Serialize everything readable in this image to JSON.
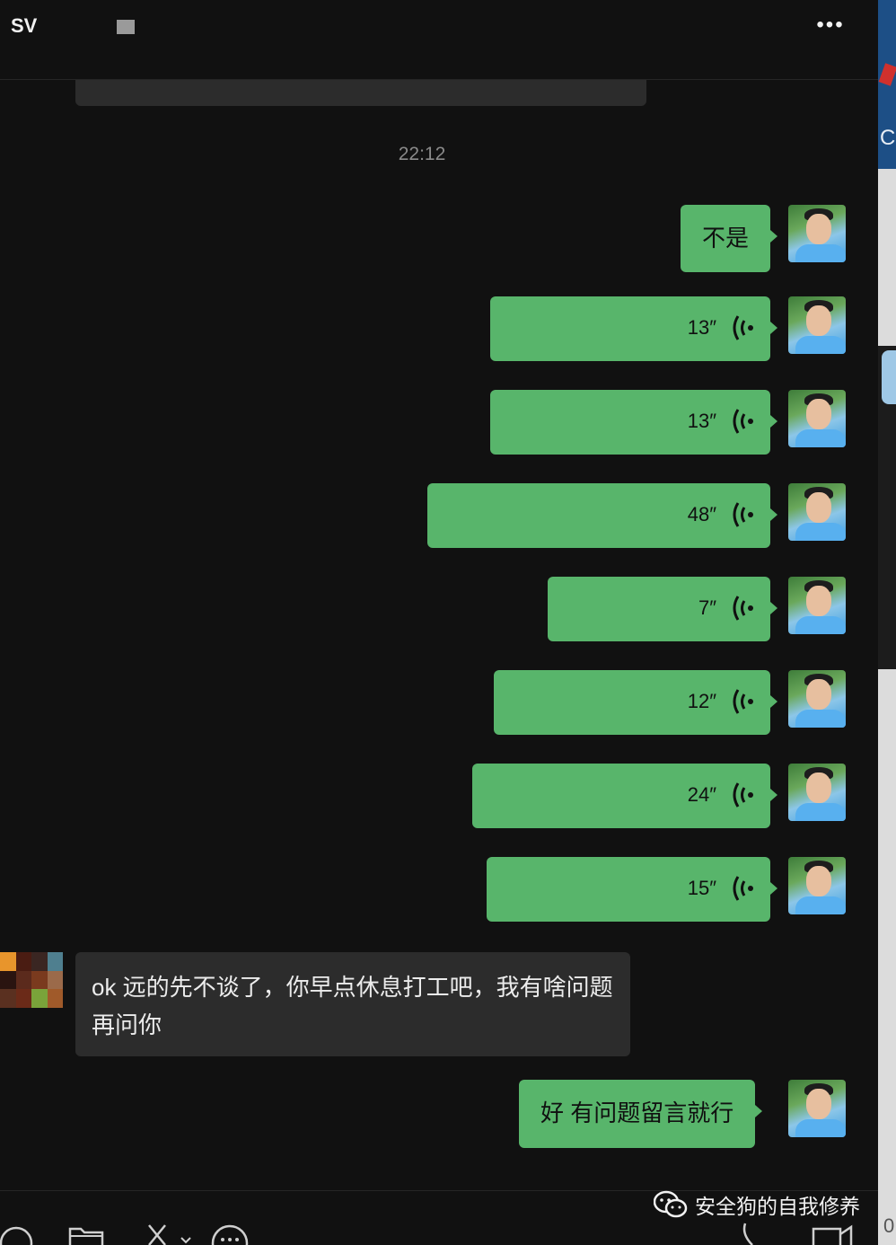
{
  "header": {
    "title": "SV",
    "more_label": "•••"
  },
  "chat": {
    "timestamp": "22:12",
    "sent_text_1": "不是",
    "voice_messages": [
      "13″",
      "13″",
      "48″",
      "7″",
      "12″",
      "24″",
      "15″"
    ],
    "received_message": "ok 远的先不谈了，你早点休息打工吧，我有啥问题再问你",
    "sent_text_2": "好 有问题留言就行"
  },
  "footer": {
    "watermark": "安全狗的自我修养"
  },
  "side_panel": {
    "letter": "C",
    "bottom_digit": "0"
  },
  "colors": {
    "background": "#111111",
    "sent_bubble": "#58b56b",
    "received_bubble": "#2c2c2c"
  }
}
